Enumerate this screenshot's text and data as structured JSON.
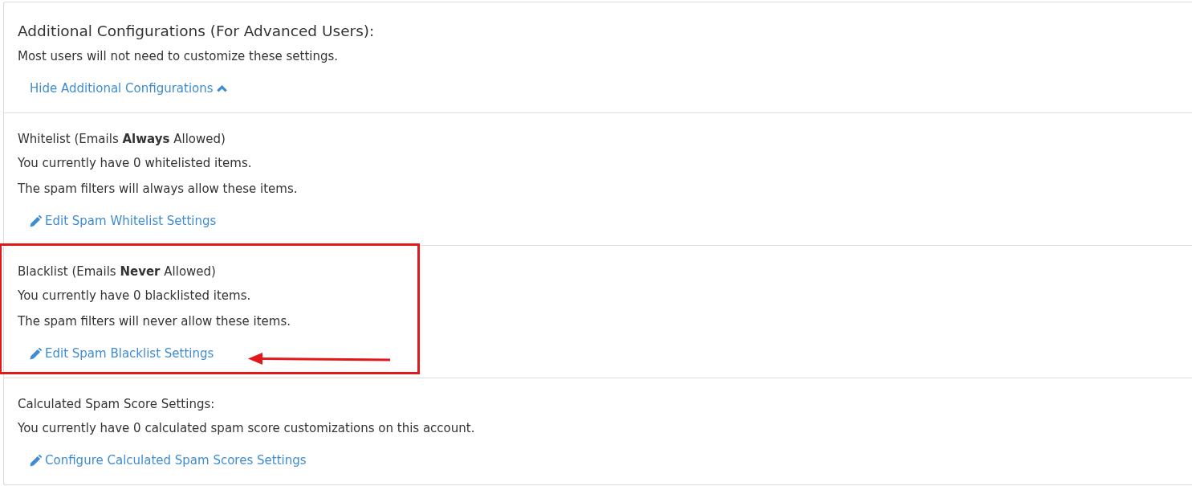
{
  "panel": {
    "header": {
      "title": "Additional Configurations (For Advanced Users):",
      "description": "Most users will not need to customize these settings.",
      "toggle": {
        "label": "Hide Additional Configurations",
        "expanded": true
      }
    },
    "sections": [
      {
        "title": "Whitelist (Emails **Always** Allowed)",
        "lines": [
          "You currently have 0 whitelisted items.",
          "The spam filters will always allow these items."
        ],
        "link": "Edit Spam Whitelist Settings",
        "highlighted": false
      },
      {
        "title": "Blacklist (Emails **Never** Allowed)",
        "lines": [
          "You currently have 0 blacklisted items.",
          "The spam filters will never allow these items."
        ],
        "link": "Edit Spam Blacklist Settings",
        "highlighted": true
      },
      {
        "title": "Calculated Spam Score Settings:",
        "lines": [
          "You currently have 0 calculated spam score customizations on this account."
        ],
        "link": "Configure Calculated Spam Scores Settings",
        "highlighted": false
      }
    ]
  }
}
